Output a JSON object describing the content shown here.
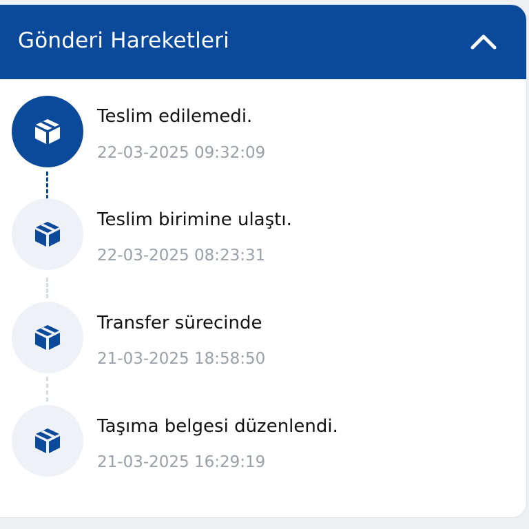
{
  "header": {
    "title": "Gönderi Hareketleri",
    "toggle_icon": "chevron-up-icon"
  },
  "colors": {
    "primary": "#0b4a9b",
    "inactive_circle": "#eef1f6",
    "timestamp": "#9aa0a7",
    "title_text": "#111111"
  },
  "events": [
    {
      "title": "Teslim edilemedi.",
      "timestamp": "22-03-2025 09:32:09",
      "state": "active",
      "icon": "package-icon"
    },
    {
      "title": "Teslim birimine ulaştı.",
      "timestamp": "22-03-2025 08:23:31",
      "state": "inactive",
      "icon": "package-icon"
    },
    {
      "title": "Transfer sürecinde",
      "timestamp": "21-03-2025 18:58:50",
      "state": "inactive",
      "icon": "package-icon"
    },
    {
      "title": "Taşıma belgesi düzenlendi.",
      "timestamp": "21-03-2025 16:29:19",
      "state": "inactive",
      "icon": "package-icon"
    }
  ]
}
